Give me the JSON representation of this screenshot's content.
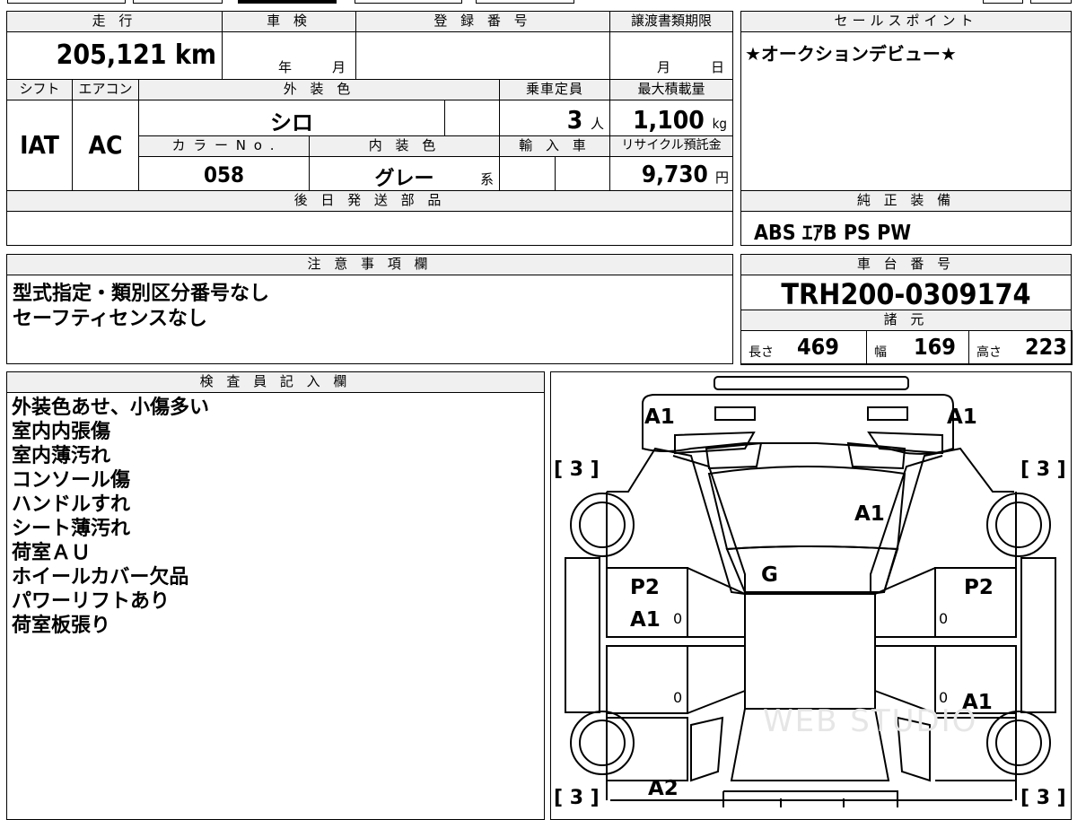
{
  "top": {
    "mileage_label": "走 行",
    "mileage": "205,121",
    "mileage_unit": "km",
    "inspection_label": "車 検",
    "inspection_year": "年",
    "inspection_month": "月",
    "registration_label": "登 録 番 号",
    "transfer_label": "譲渡書類期限",
    "transfer_month": "月",
    "transfer_day": "日"
  },
  "specs": {
    "shift_label": "シフト",
    "shift": "IAT",
    "ac_label": "エアコン",
    "ac": "AC",
    "exterior_label": "外 装 色",
    "exterior": "シロ",
    "capacity_label": "乗車定員",
    "capacity": "3",
    "capacity_unit": "人",
    "maxload_label": "最大積載量",
    "maxload": "1,100",
    "maxload_unit": "kg",
    "color_no_label": "カ ラ ー N o .",
    "color_no": "058",
    "interior_label": "内 装 色",
    "interior": "グレー",
    "interior_unit": "系",
    "import_label": "輸 入 車",
    "recycle_label": "リサイクル預託金",
    "recycle": "9,730",
    "recycle_unit": "円",
    "parts_label": "後 日 発 送 部 品"
  },
  "sales": {
    "label": "セールスポイント",
    "text": "★オークションデビュー★"
  },
  "equipment": {
    "label": "純 正 装 備",
    "text": "ABS ｴｱB PS PW"
  },
  "notes": {
    "label": "注 意 事 項 欄",
    "lines": [
      "型式指定・類別区分番号なし",
      "セーフティセンスなし"
    ]
  },
  "chassis": {
    "label": "車 台 番 号",
    "number": "TRH200-0309174",
    "dims_label": "諸 元",
    "length_label": "長さ",
    "length": "469",
    "width_label": "幅",
    "width": "169",
    "height_label": "高さ",
    "height": "223"
  },
  "inspector": {
    "label": "検 査 員 記 入 欄",
    "lines": [
      "外装色あせ、小傷多い",
      "室内内張傷",
      "室内薄汚れ",
      "コンソール傷",
      "ハンドルすれ",
      "シート薄汚れ",
      "荷室ＡＵ",
      "ホイールカバー欠品",
      "パワーリフトあり",
      "荷室板張り"
    ]
  },
  "diagram": {
    "front_left": "A1",
    "front_right": "A1",
    "tire_fl": "[ 3 ]",
    "tire_fr": "[ 3 ]",
    "tire_rl": "[ 3 ]",
    "tire_rr": "[ 3 ]",
    "windshield": "A1",
    "roof": "G",
    "left_front_door_1": "P2",
    "left_front_door_2": "A1",
    "right_front_door": "P2",
    "right_rear_door": "A1",
    "rear": "A2",
    "zero_mark": "0",
    "watermark": "WEB STUDIO"
  }
}
